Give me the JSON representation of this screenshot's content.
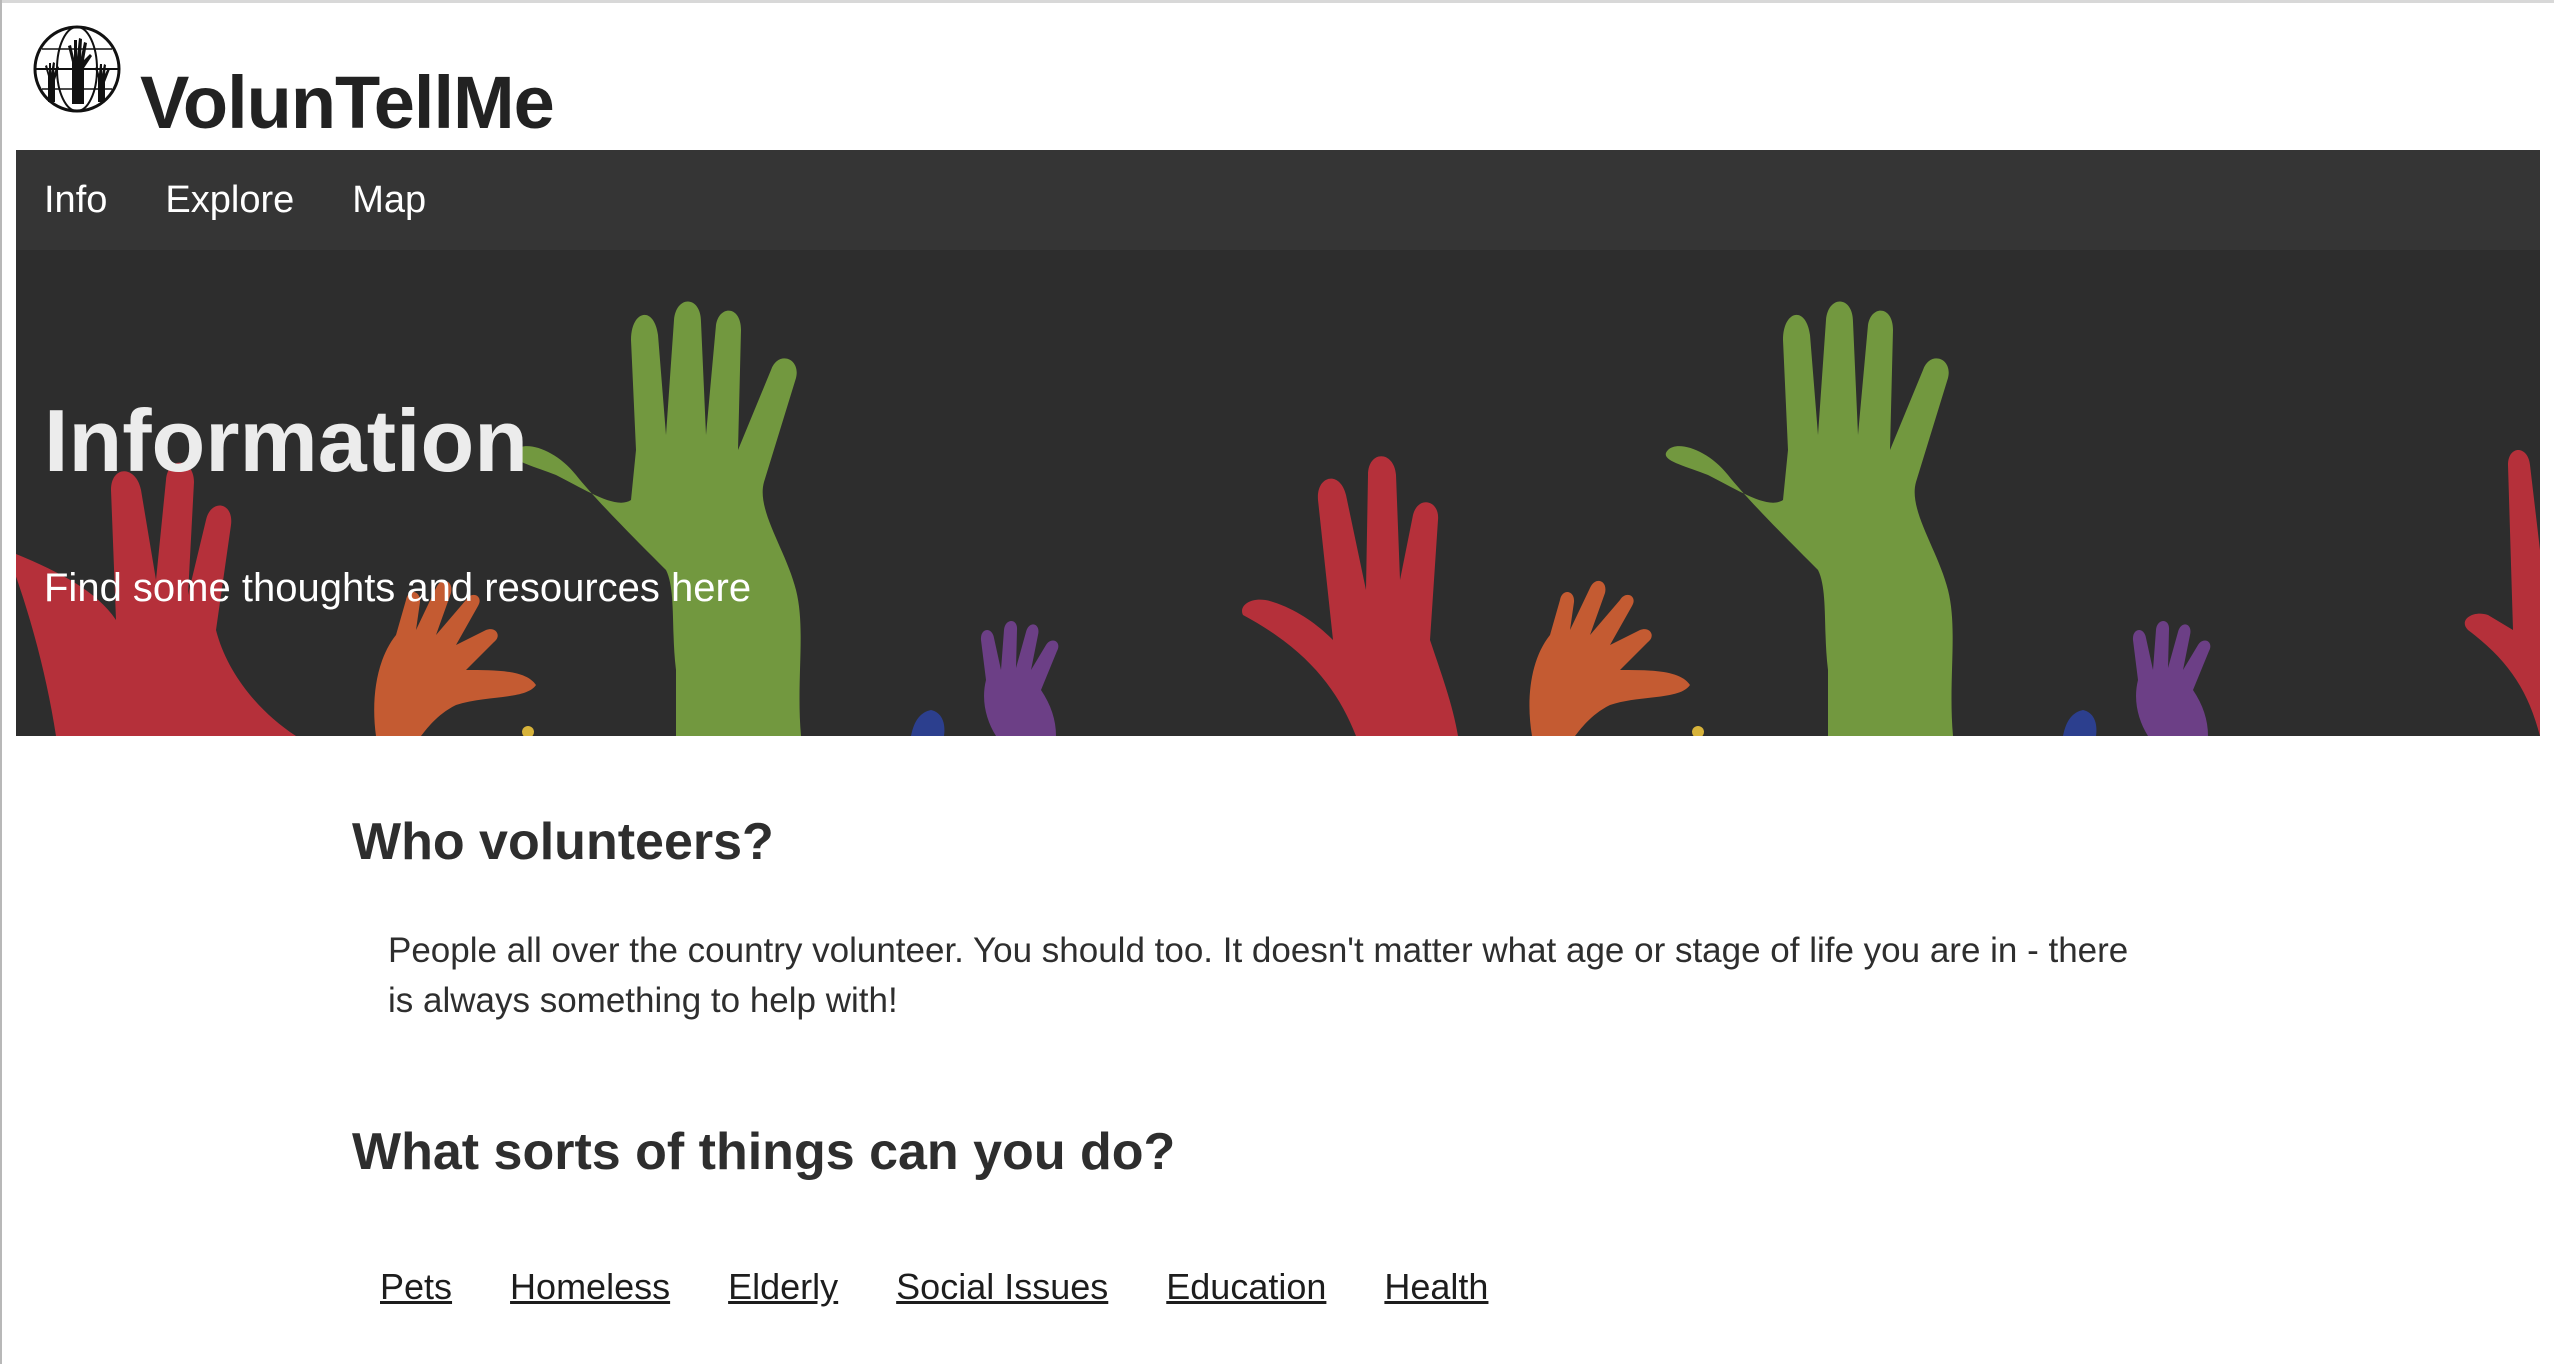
{
  "header": {
    "logo_icon": "raised-hands-globe-icon",
    "brand": "VolunTellMe"
  },
  "nav": {
    "items": [
      {
        "label": "Info"
      },
      {
        "label": "Explore"
      },
      {
        "label": "Map"
      }
    ]
  },
  "hero": {
    "title": "Information",
    "subtitle": "Find some thoughts and resources here",
    "background_icon": "raised-hands-illustration",
    "colors": {
      "background": "#2d2d2d",
      "green": "#72983f",
      "red": "#b5303a",
      "orange": "#c45b32",
      "purple": "#6c3f86",
      "blue": "#2c3f8e",
      "yellow": "#d7b33a"
    }
  },
  "main": {
    "who_heading": "Who volunteers?",
    "who_text": "People all over the country volunteer. You should too. It doesn't matter what age or stage of life you are in - there is always something to help with!",
    "what_heading": "What sorts of things can you do?",
    "categories": [
      {
        "label": "Pets"
      },
      {
        "label": "Homeless"
      },
      {
        "label": "Elderly"
      },
      {
        "label": "Social Issues"
      },
      {
        "label": "Education"
      },
      {
        "label": "Health"
      }
    ]
  },
  "colors": {
    "nav_background": "#353535",
    "text": "#2e2e2e"
  }
}
